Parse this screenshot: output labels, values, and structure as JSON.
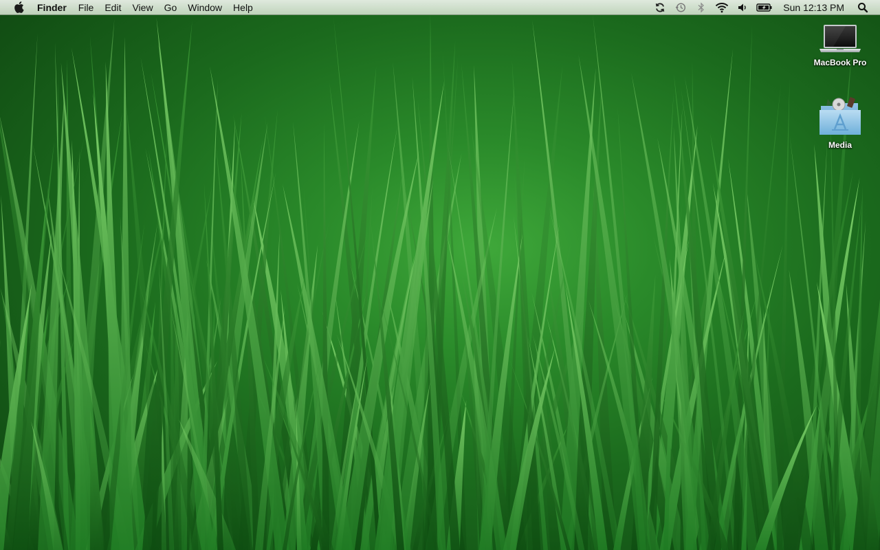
{
  "menubar": {
    "app_name": "Finder",
    "menus": [
      "File",
      "Edit",
      "View",
      "Go",
      "Window",
      "Help"
    ],
    "status_icons": [
      "sync-icon",
      "time-machine-icon",
      "bluetooth-icon",
      "wifi-icon",
      "volume-icon",
      "battery-icon"
    ],
    "clock": "Sun 12:13 PM",
    "spotlight_icon": "spotlight-search-icon"
  },
  "desktop": {
    "icons": [
      {
        "label": "MacBook Pro",
        "icon": "laptop-icon"
      },
      {
        "label": "Media",
        "icon": "app-store-folder-icon"
      }
    ]
  },
  "colors": {
    "wallpaper_primary": "#2a8a2a",
    "wallpaper_dark": "#0e4310"
  }
}
